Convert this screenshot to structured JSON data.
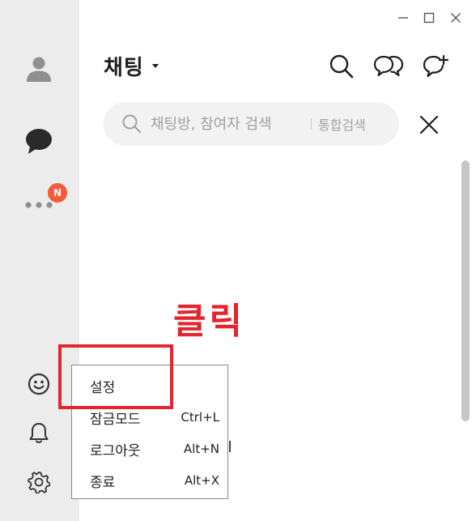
{
  "window": {
    "minimize_icon": "minimize-icon",
    "maximize_icon": "maximize-icon",
    "close_icon": "close-icon"
  },
  "sidebar": {
    "items": [
      {
        "name": "friends",
        "icon": "person-icon"
      },
      {
        "name": "chat",
        "icon": "chat-bubble-icon"
      },
      {
        "name": "more",
        "icon": "more-dots-icon",
        "badge": "N"
      }
    ],
    "bottom": [
      {
        "name": "emoticon",
        "icon": "smiley-icon"
      },
      {
        "name": "notifications",
        "icon": "bell-icon"
      },
      {
        "name": "settings",
        "icon": "gear-icon"
      }
    ]
  },
  "header": {
    "title": "채팅"
  },
  "search": {
    "placeholder": "채팅방, 참여자 검색",
    "integrated_label": "통합검색"
  },
  "annotation": {
    "text": "클릭",
    "color": "#e3252d"
  },
  "menu": {
    "items": [
      {
        "label": "설정",
        "shortcut": ""
      },
      {
        "label": "잠금모드",
        "shortcut": "Ctrl+L"
      },
      {
        "label": "로그아웃",
        "shortcut": "Alt+N"
      },
      {
        "label": "종료",
        "shortcut": "Alt+X"
      }
    ]
  },
  "colors": {
    "sidebar_bg": "#ececed",
    "badge": "#f55a3b",
    "icon": "#3a3a3a"
  }
}
